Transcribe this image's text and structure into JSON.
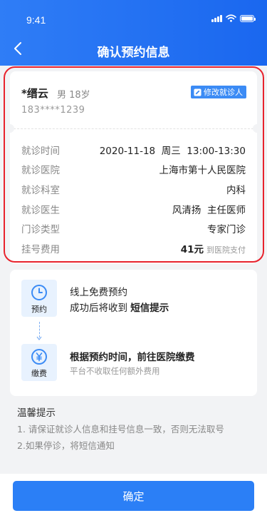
{
  "status_bar": {
    "time": "9:41"
  },
  "nav": {
    "title": "确认预约信息"
  },
  "patient": {
    "name": "*缙云",
    "gender_age": "男 18岁",
    "phone": "183****1239",
    "edit_label": "修改就诊人"
  },
  "appointment": {
    "rows": [
      {
        "label": "就诊时间",
        "value": "2020-11-18  周三  13:00-13:30"
      },
      {
        "label": "就诊医院",
        "value": "上海市第十人民医院"
      },
      {
        "label": "就诊科室",
        "value": "内科"
      },
      {
        "label": "就诊医生",
        "value": "风清扬  主任医师"
      },
      {
        "label": "门诊类型",
        "value": "专家门诊"
      }
    ],
    "fee": {
      "label": "挂号费用",
      "amount": "41元",
      "note": "到医院支付"
    }
  },
  "steps": {
    "step1": {
      "icon": "clock-icon",
      "label": "预约",
      "line1": "线上免费预约",
      "line2_prefix": "成功后将收到 ",
      "line2_bold": "短信提示"
    },
    "step2": {
      "icon": "yuan-coin-icon",
      "label": "缴费",
      "line1": "根据预约时间，前往医院缴费",
      "line2": "平台不收取任何额外费用"
    }
  },
  "tips": {
    "title": "温馨提示",
    "items": [
      "1. 请保证就诊人信息和挂号信息一致，否则无法取号",
      "2.如果停诊，将短信通知"
    ]
  },
  "confirm_label": "确定",
  "colors": {
    "primary": "#2b7ff6",
    "highlight_border": "#e8232d",
    "step_bg": "#e8f2fe"
  }
}
